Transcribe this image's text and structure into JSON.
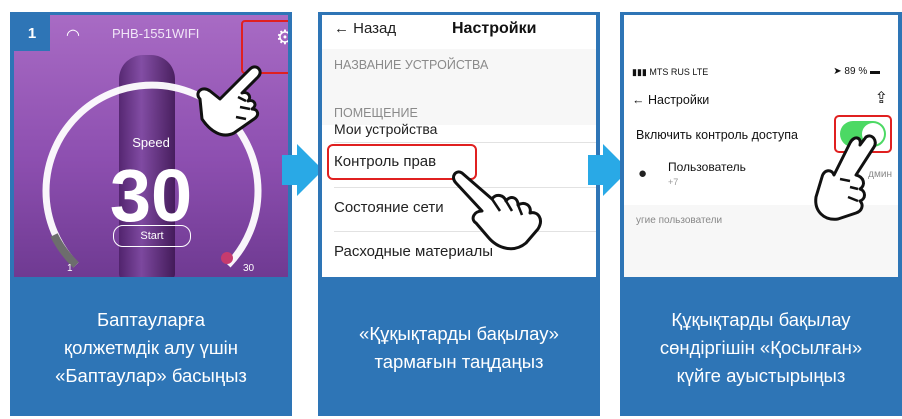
{
  "steps": [
    {
      "number": "1",
      "caption": "Баптауларға\nқолжетмдік алу үшін\n«Баптаулар» басыңыз",
      "screen": {
        "device_name": "PHB-1551WIFI",
        "speed_label": "Speed",
        "speed_value": "30",
        "start_label": "Start",
        "scale_min": "1",
        "scale_max": "30",
        "icons": [
          "wifi-icon",
          "gear-icon",
          "pointing-hand-icon"
        ]
      }
    },
    {
      "caption": "«Құқықтарды бақылау»\nтармағын таңдаңыз",
      "screen": {
        "back_label": "← Назад",
        "title": "Настройки",
        "section_device_name": "НАЗВАНИЕ УСТРОЙСТВА",
        "section_room": "ПОМЕЩЕНИЕ",
        "room_value": "Мои устройства",
        "items": [
          "Контроль прав",
          "Состояние сети",
          "Расходные материалы"
        ]
      }
    },
    {
      "caption": "Құқықтарды бақылау\nсөндіргішін «Қосылған»\nкүйге ауыстырыңыз",
      "screen": {
        "carrier": "MTS RUS  LTE",
        "battery": "89 %",
        "back_label": "← Настройки",
        "toggle_label": "Включить контроль доступа",
        "toggle_on": true,
        "user_name": "Пользователь",
        "user_phone": "+7",
        "user_role": "дмин",
        "others_label": "угие пользователи"
      }
    }
  ],
  "colors": {
    "panel_blue": "#2e75b6",
    "arrow_blue": "#29a9e6",
    "highlight_red": "#e02020",
    "toggle_green": "#4cd964"
  }
}
